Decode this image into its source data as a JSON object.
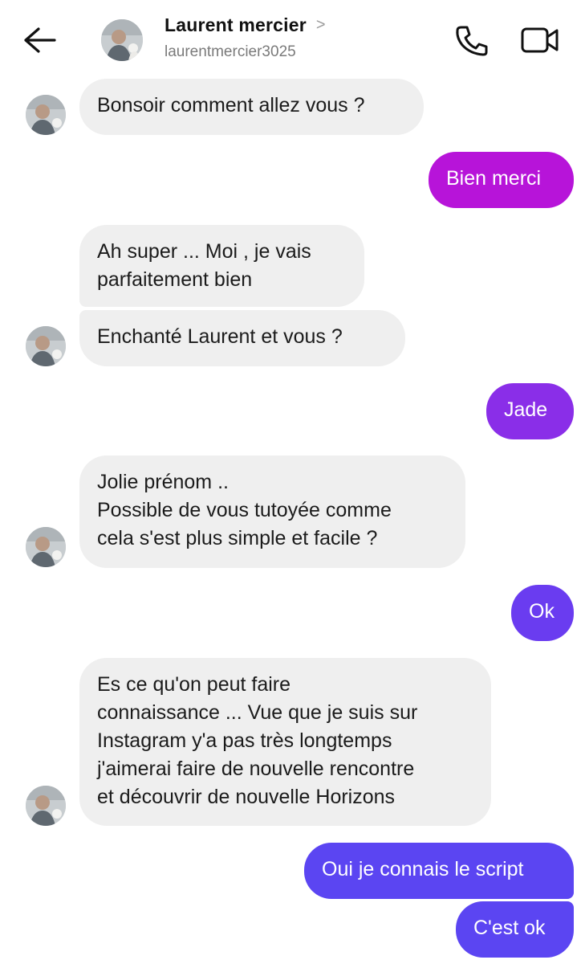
{
  "header": {
    "back_icon": "arrow-left-icon",
    "name": "Laurent mercier",
    "chevron": ">",
    "username": "laurentmercier3025",
    "call_icon": "phone-icon",
    "video_icon": "video-camera-icon"
  },
  "messages": [
    {
      "from": "them",
      "text": "Bonsoir comment allez vous ?"
    },
    {
      "from": "me",
      "text": "Bien merci",
      "color": "#b714d9"
    },
    {
      "from": "them",
      "text": "Ah super ... Moi , je vais\nparfaitement bien"
    },
    {
      "from": "them",
      "text": "Enchanté  Laurent et vous ?"
    },
    {
      "from": "me",
      "text": "Jade",
      "color": "#8a2ee8"
    },
    {
      "from": "them",
      "text": "Jolie prénom ..\nPossible de vous tutoyée comme\ncela s'est plus simple et facile ?"
    },
    {
      "from": "me",
      "text": "Ok",
      "color": "#6a3cf0"
    },
    {
      "from": "them",
      "text": "Es ce qu'on peut faire\nconnaissance ... Vue que je suis sur\nInstagram y'a pas très  longtemps\nj'aimerai faire de nouvelle rencontre\net découvrir de nouvelle Horizons"
    },
    {
      "from": "me",
      "text": "Oui je connais le script",
      "color": "#5b45f2"
    },
    {
      "from": "me",
      "text": "C'est ok",
      "color": "#5b45f2"
    }
  ]
}
